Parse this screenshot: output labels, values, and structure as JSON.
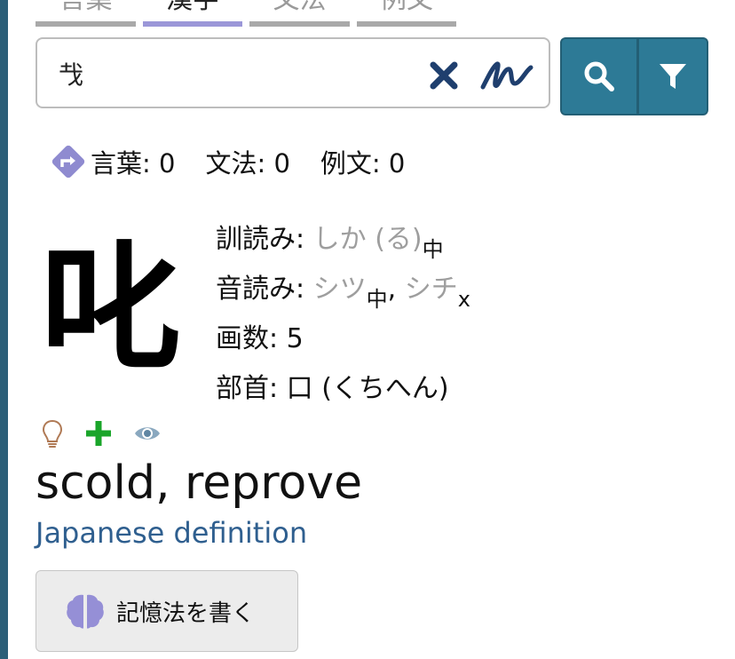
{
  "tabs": [
    {
      "label": "言葉",
      "active": false
    },
    {
      "label": "漢字",
      "active": true
    },
    {
      "label": "文法",
      "active": false
    },
    {
      "label": "例文",
      "active": false
    }
  ],
  "search": {
    "value": "𢦏",
    "placeholder": ""
  },
  "stats": {
    "words": "言葉: 0",
    "grammar": "文法: 0",
    "sentences": "例文: 0"
  },
  "kanji": {
    "character": "叱",
    "kun_label": "訓読み: ",
    "kun_value": "しか (る)",
    "kun_freq": "中",
    "on_label": "音読み: ",
    "on_value_1": "シツ",
    "on_freq_1": "中",
    "on_sep": ", ",
    "on_value_2": "シチ",
    "on_freq_2": "x",
    "strokes_label": "画数: ",
    "strokes_value": "5",
    "radical_label": "部首: ",
    "radical_value": "口 (くちへん)"
  },
  "meaning": "scold, reprove",
  "japanese_definition": "Japanese definition",
  "mnemonic_button": "記憶法を書く",
  "colors": {
    "accent": "#2d7a96",
    "tab_active": "#9b97d8",
    "link": "#2f5f8f",
    "plus": "#1aa52a",
    "redirect": "#8f8bd0"
  }
}
